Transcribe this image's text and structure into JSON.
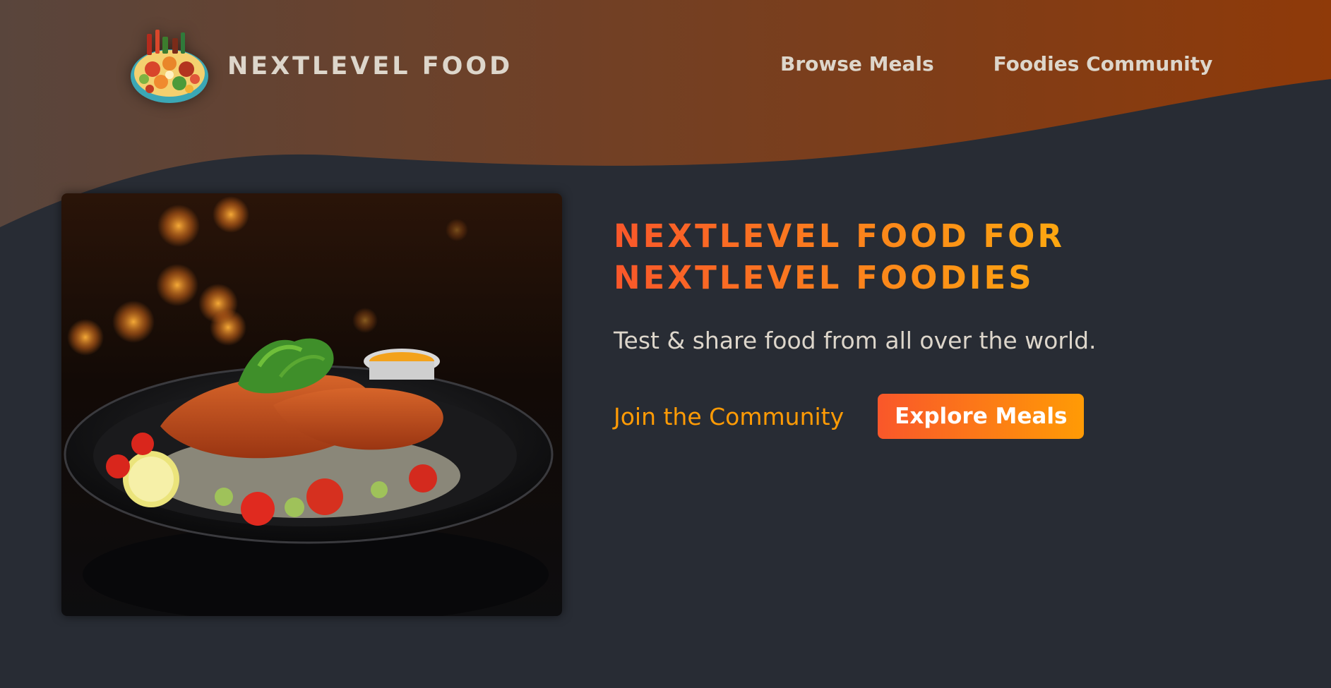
{
  "header": {
    "logo_alt": "A plate with food on it",
    "logo_text": "NEXTLEVEL FOOD",
    "nav": [
      {
        "label": "Browse Meals"
      },
      {
        "label": "Foodies Community"
      }
    ]
  },
  "hero": {
    "image_alt": "A delicious, juicy schnitzel on a plate",
    "title_line1": "NEXTLEVEL FOOD FOR",
    "title_line2": "NEXTLEVEL FOODIES",
    "subtitle": "Test & share food from all over the world.",
    "cta_link_label": "Join the Community",
    "cta_button_label": "Explore Meals"
  },
  "colors": {
    "background": "#282c34",
    "header_gradient_start": "#59453c",
    "header_gradient_end": "#8f3a09",
    "accent_orange": "#f9572a",
    "accent_amber": "#ff9b05",
    "text_light": "#ddd6cb"
  }
}
